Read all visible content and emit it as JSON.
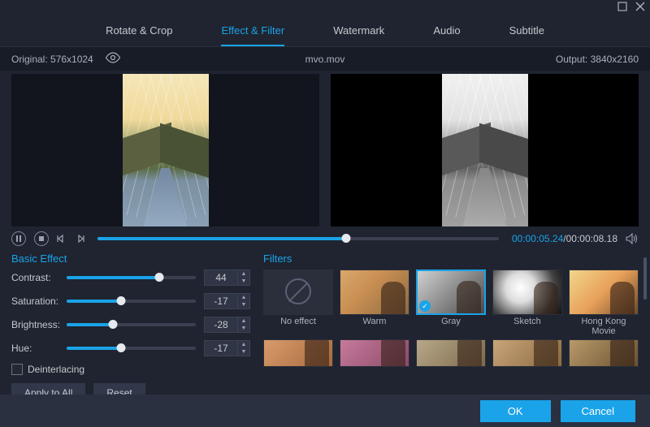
{
  "tabs": [
    {
      "label": "Rotate & Crop"
    },
    {
      "label": "Effect & Filter"
    },
    {
      "label": "Watermark"
    },
    {
      "label": "Audio"
    },
    {
      "label": "Subtitle"
    }
  ],
  "active_tab": "Effect & Filter",
  "info": {
    "original": "Original: 576x1024",
    "filename": "mvo.mov",
    "output": "Output: 3840x2160"
  },
  "playback": {
    "current_time": "00:00:05.24",
    "total_time": "/00:00:08.18",
    "progress_pct": 62
  },
  "basic_effect": {
    "title": "Basic Effect",
    "rows": [
      {
        "label": "Contrast:",
        "value": "44",
        "pct": 72
      },
      {
        "label": "Saturation:",
        "value": "-17",
        "pct": 42
      },
      {
        "label": "Brightness:",
        "value": "-28",
        "pct": 36
      },
      {
        "label": "Hue:",
        "value": "-17",
        "pct": 42
      }
    ],
    "deinterlacing": "Deinterlacing",
    "apply_all": "Apply to All",
    "reset": "Reset"
  },
  "filters": {
    "title": "Filters",
    "row1": [
      {
        "label": "No effect"
      },
      {
        "label": "Warm"
      },
      {
        "label": "Gray"
      },
      {
        "label": "Sketch"
      },
      {
        "label": "Hong Kong Movie"
      }
    ],
    "selected": "Gray"
  },
  "footer": {
    "ok": "OK",
    "cancel": "Cancel"
  }
}
